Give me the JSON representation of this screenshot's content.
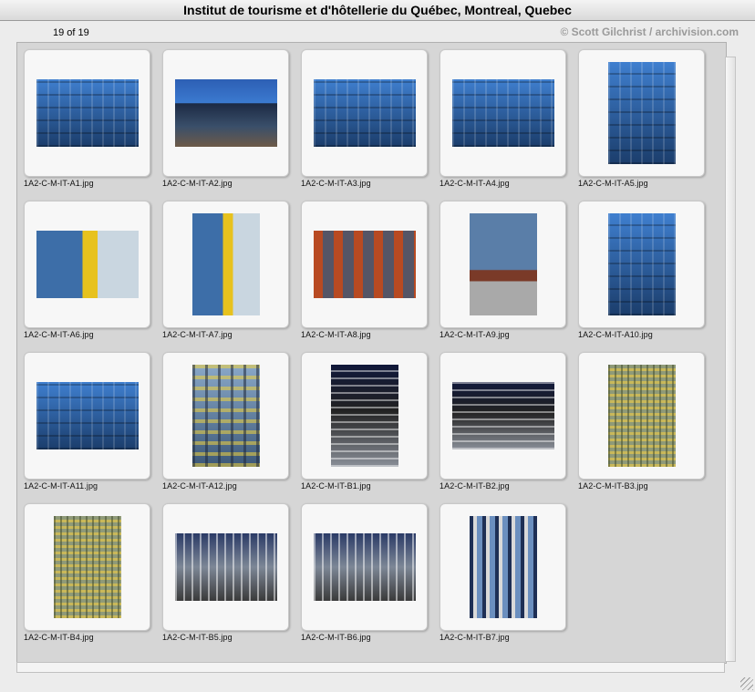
{
  "window": {
    "title": "Institut de tourisme et d'hôtellerie du Québec, Montreal, Quebec"
  },
  "header": {
    "count": "19 of 19",
    "credit": "© Scott Gilchrist / archivision.com"
  },
  "thumbnails": [
    {
      "filename": "1A2-C-M-IT-A1.jpg",
      "style": "p-glass",
      "orientation": "landscape"
    },
    {
      "filename": "1A2-C-M-IT-A2.jpg",
      "style": "p-sky",
      "orientation": "landscape"
    },
    {
      "filename": "1A2-C-M-IT-A3.jpg",
      "style": "p-glass",
      "orientation": "landscape"
    },
    {
      "filename": "1A2-C-M-IT-A4.jpg",
      "style": "p-glass",
      "orientation": "landscape"
    },
    {
      "filename": "1A2-C-M-IT-A5.jpg",
      "style": "p-glass",
      "orientation": "portrait"
    },
    {
      "filename": "1A2-C-M-IT-A6.jpg",
      "style": "p-yb",
      "orientation": "landscape"
    },
    {
      "filename": "1A2-C-M-IT-A7.jpg",
      "style": "p-yb",
      "orientation": "portrait"
    },
    {
      "filename": "1A2-C-M-IT-A8.jpg",
      "style": "p-red",
      "orientation": "landscape"
    },
    {
      "filename": "1A2-C-M-IT-A9.jpg",
      "style": "p-brick",
      "orientation": "portrait"
    },
    {
      "filename": "1A2-C-M-IT-A10.jpg",
      "style": "p-glass",
      "orientation": "portrait"
    },
    {
      "filename": "1A2-C-M-IT-A11.jpg",
      "style": "p-glass",
      "orientation": "landscape"
    },
    {
      "filename": "1A2-C-M-IT-A12.jpg",
      "style": "p-yellow",
      "orientation": "portrait"
    },
    {
      "filename": "1A2-C-M-IT-B1.jpg",
      "style": "p-dark",
      "orientation": "portrait"
    },
    {
      "filename": "1A2-C-M-IT-B2.jpg",
      "style": "p-dark",
      "orientation": "landscape"
    },
    {
      "filename": "1A2-C-M-IT-B3.jpg",
      "style": "p-gold",
      "orientation": "portrait"
    },
    {
      "filename": "1A2-C-M-IT-B4.jpg",
      "style": "p-gold",
      "orientation": "portrait"
    },
    {
      "filename": "1A2-C-M-IT-B5.jpg",
      "style": "p-grey",
      "orientation": "landscape"
    },
    {
      "filename": "1A2-C-M-IT-B6.jpg",
      "style": "p-grey",
      "orientation": "landscape"
    },
    {
      "filename": "1A2-C-M-IT-B7.jpg",
      "style": "p-mosaic",
      "orientation": "portrait"
    }
  ]
}
